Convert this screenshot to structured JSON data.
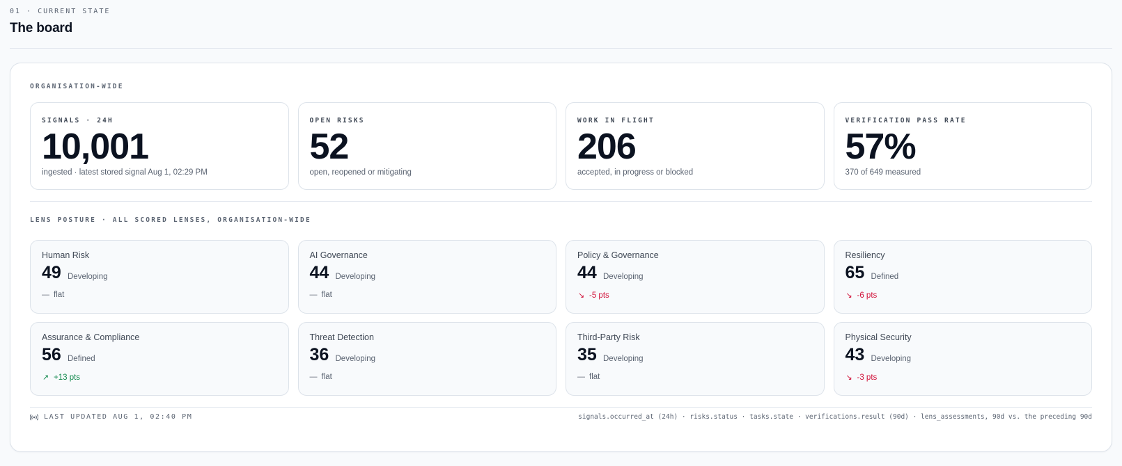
{
  "header": {
    "eyebrow": "01 · CURRENT STATE",
    "title": "The board"
  },
  "org": {
    "section_label": "ORGANISATION-WIDE",
    "stats": [
      {
        "label": "SIGNALS · 24H",
        "value": "10,001",
        "caption": "ingested · latest stored signal Aug 1, 02:29 PM"
      },
      {
        "label": "OPEN RISKS",
        "value": "52",
        "caption": "open, reopened or mitigating"
      },
      {
        "label": "WORK IN FLIGHT",
        "value": "206",
        "caption": "accepted, in progress or blocked"
      },
      {
        "label": "VERIFICATION PASS RATE",
        "value": "57%",
        "caption": "370 of 649 measured"
      }
    ]
  },
  "lens": {
    "section_label": "LENS POSTURE · ALL SCORED LENSES, ORGANISATION-WIDE",
    "items": [
      {
        "name": "Human Risk",
        "score": "49",
        "level": "Developing",
        "trend": "flat",
        "direction": "flat"
      },
      {
        "name": "AI Governance",
        "score": "44",
        "level": "Developing",
        "trend": "flat",
        "direction": "flat"
      },
      {
        "name": "Policy & Governance",
        "score": "44",
        "level": "Developing",
        "trend": "-5 pts",
        "direction": "down"
      },
      {
        "name": "Resiliency",
        "score": "65",
        "level": "Defined",
        "trend": "-6 pts",
        "direction": "down"
      },
      {
        "name": "Assurance & Compliance",
        "score": "56",
        "level": "Defined",
        "trend": "+13 pts",
        "direction": "up"
      },
      {
        "name": "Threat Detection",
        "score": "36",
        "level": "Developing",
        "trend": "flat",
        "direction": "flat"
      },
      {
        "name": "Third-Party Risk",
        "score": "35",
        "level": "Developing",
        "trend": "flat",
        "direction": "flat"
      },
      {
        "name": "Physical Security",
        "score": "43",
        "level": "Developing",
        "trend": "-3 pts",
        "direction": "down"
      }
    ]
  },
  "footer": {
    "updated": "LAST UPDATED AUG 1, 02:40 PM",
    "sources": "signals.occurred_at (24h) · risks.status · tasks.state · verifications.result (90d) · lens_assessments, 90d vs. the preceding 90d",
    "icon": "broadcast-icon"
  },
  "colors": {
    "trend_down": "#d1123a",
    "trend_up": "#138a4e",
    "trend_flat": "#5b6472"
  }
}
